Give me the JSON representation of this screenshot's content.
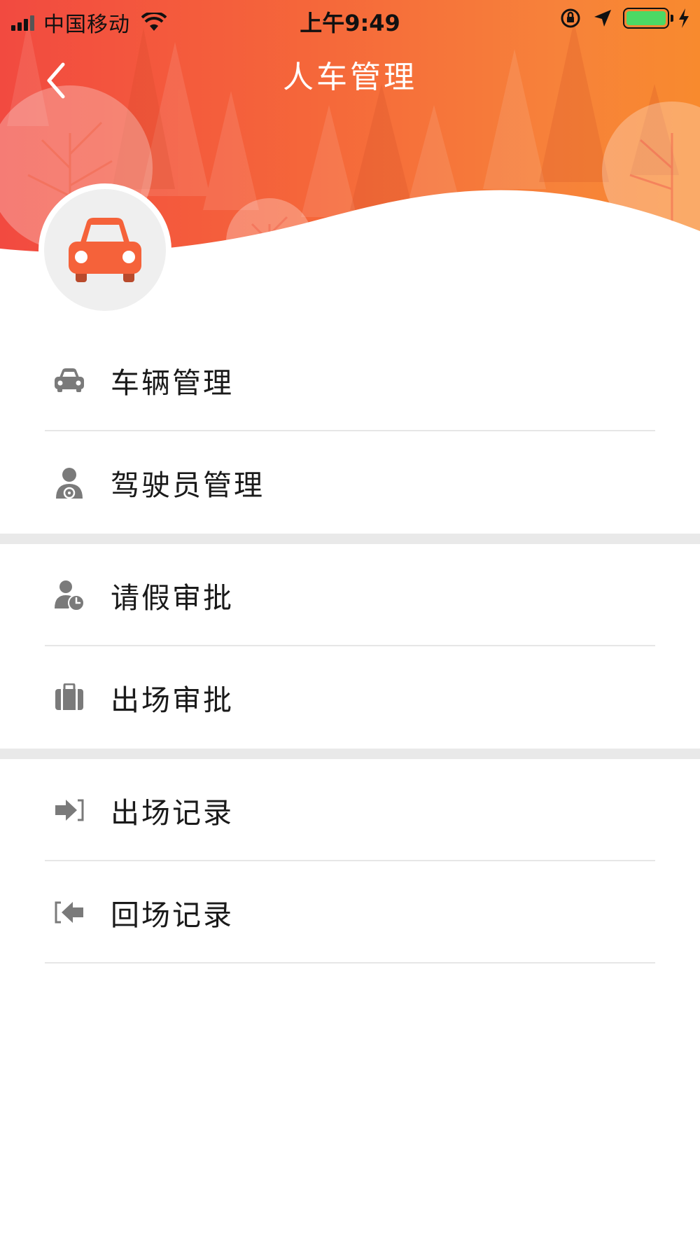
{
  "status_bar": {
    "carrier": "中国移动",
    "time": "上午9:49"
  },
  "nav": {
    "title": "人车管理"
  },
  "colors": {
    "accent": "#f5623a",
    "icon_gray": "#7a7a7a"
  },
  "menu": {
    "groups": [
      {
        "items": [
          {
            "label": "车辆管理",
            "icon": "car-icon"
          },
          {
            "label": "驾驶员管理",
            "icon": "driver-icon"
          }
        ]
      },
      {
        "items": [
          {
            "label": "请假审批",
            "icon": "leave-approval-icon"
          },
          {
            "label": "出场审批",
            "icon": "briefcase-icon"
          }
        ]
      },
      {
        "items": [
          {
            "label": "出场记录",
            "icon": "exit-icon"
          },
          {
            "label": "回场记录",
            "icon": "return-icon"
          }
        ]
      }
    ]
  }
}
